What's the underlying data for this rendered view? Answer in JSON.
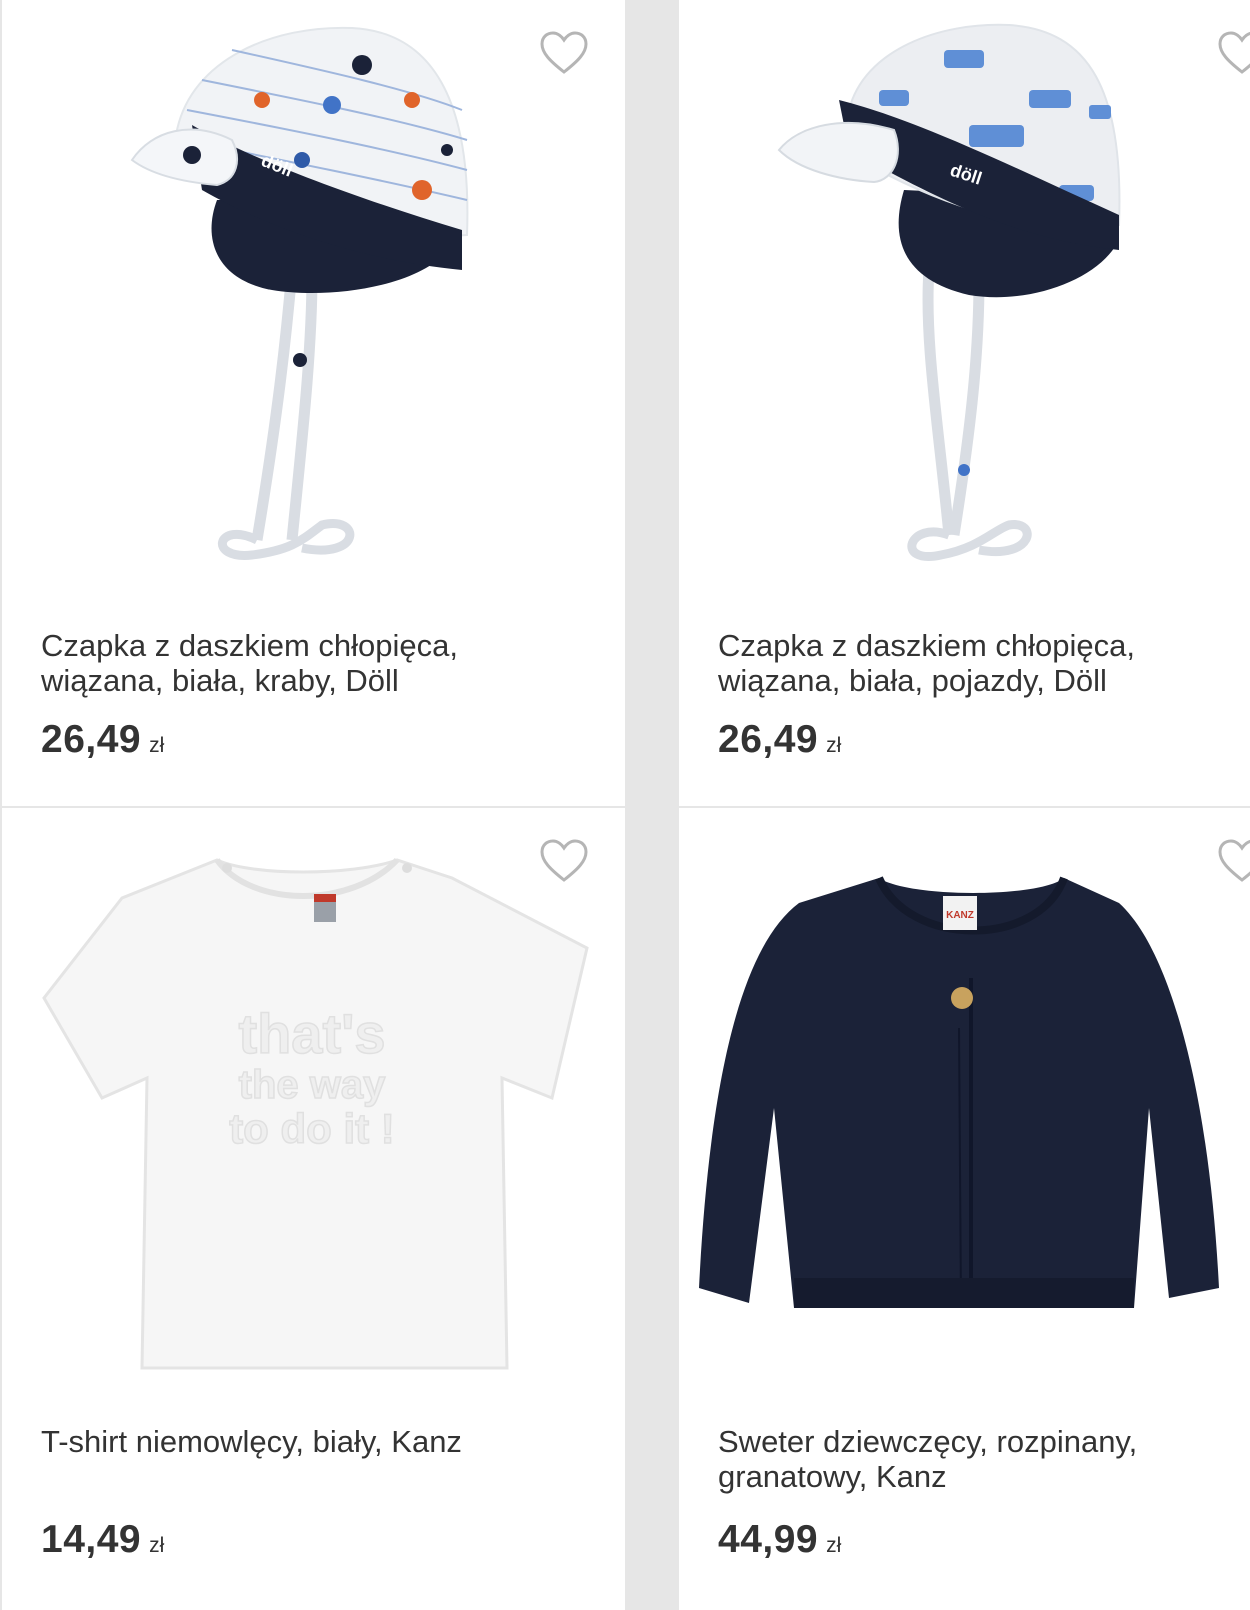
{
  "products": [
    {
      "title": "Czapka z daszkiem chłopięca, wiązana, biała, kraby, Döll",
      "price": "26,49",
      "currency": "zł",
      "image": "cap-crabs",
      "favorite_icon": "heart-outline-icon"
    },
    {
      "title": "Czapka z daszkiem chłopięca, wiązana, biała, pojazdy, Döll",
      "price": "26,49",
      "currency": "zł",
      "image": "cap-vehicles",
      "favorite_icon": "heart-outline-icon"
    },
    {
      "title": "T-shirt niemowlęcy, biały, Kanz",
      "price": "14,49",
      "currency": "zł",
      "image": "white-tshirt",
      "favorite_icon": "heart-outline-icon"
    },
    {
      "title": "Sweter dziewczęcy, rozpinany, granatowy, Kanz",
      "price": "44,99",
      "currency": "zł",
      "image": "navy-cardigan",
      "favorite_icon": "heart-outline-icon"
    }
  ],
  "product_images": {
    "cap_brand": "döll",
    "tshirt_print": [
      "that's",
      "the way",
      "to do it !"
    ],
    "cardigan_label": "KANZ"
  },
  "colors": {
    "navy": "#1b2238",
    "text": "#333333",
    "heart": "#b5b5b5",
    "background": "#e6e6e6"
  }
}
